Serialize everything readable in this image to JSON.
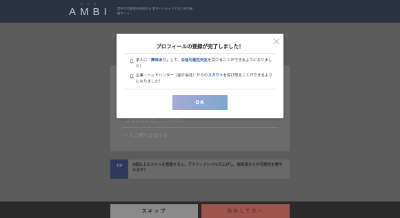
{
  "header": {
    "logo_text": "AMBI",
    "logo_kana": "アンビ",
    "tagline": "若手の可能性を評価する 若手ハイキャリアのための転職サイト"
  },
  "form": {
    "skill_placeholder": "スキルを入力してください",
    "add_field_label": "＋ 入力欄を追加する"
  },
  "tip": {
    "icon_label": "TIP",
    "text": "5個以上のスキルを登録すると、アクティブレベルが上がし、採用者からの可能性を増やせます！"
  },
  "footer": {
    "skip_label": "スキップ",
    "next_label": "保存して次へ"
  },
  "modal": {
    "title": "プロフィールの登録が完了しました！",
    "item1": {
      "pre": "求人に「",
      "highlight1": "興味あり",
      "mid": "」して、",
      "highlight2": "合格可能性判定",
      "post": "を受けることができるようになりました！"
    },
    "item2": {
      "pre": "企業・ヘッドハンター（紹介会社）からの",
      "highlight1": "スカウト",
      "post": "を受け取ることができるようになりました！"
    },
    "ok_label": "OK"
  },
  "colors": {
    "header_bg": "#2a3344",
    "highlight": "#2d59a7",
    "ok_gradient_start": "#a6aad6",
    "ok_gradient_end": "#7fa6cf"
  }
}
